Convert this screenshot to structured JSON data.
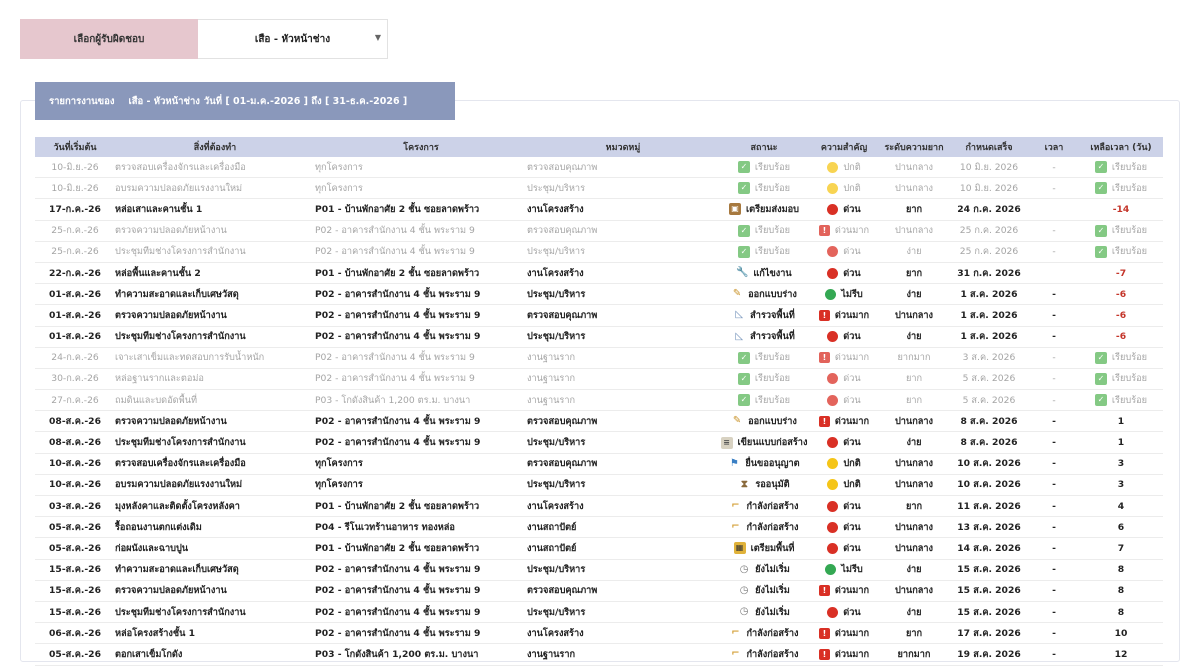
{
  "responsible": {
    "label": "เลือกผู้รับผิดชอบ",
    "selected": "เสือ - หัวหน้าช่าง"
  },
  "banner": {
    "prefix": "รายการงานของ",
    "person": "เสือ - หัวหน้าช่าง",
    "range": "วันที่ [ 01-ม.ค.-2026 ] ถึง [ 31-ธ.ค.-2026 ]"
  },
  "headers": [
    "วันที่เริ่มต้น",
    "สิ่งที่ต้องทำ",
    "โครงการ",
    "หมวดหมู่",
    "สถานะ",
    "ความสำคัญ",
    "ระดับความยาก",
    "กำหนดเสร็จ",
    "เวลา",
    "เหลือเวลา (วัน)"
  ],
  "rows": [
    {
      "state": "done",
      "start": "10-มิ.ย.-26",
      "task": "ตรวจสอบเครื่องจักรและเครื่องมือ",
      "project": "ทุกโครงการ",
      "category": "ตรวจสอบคุณภาพ",
      "status_icon": "check-icon",
      "status": "เรียบร้อย",
      "priority_icon": "yellow-dot",
      "priority": "ปกติ",
      "difficulty": "ปานกลาง",
      "due": "10 มิ.ย. 2026",
      "time": "-",
      "remain_icon": "check-icon",
      "remain": "เรียบร้อย"
    },
    {
      "state": "done",
      "start": "10-มิ.ย.-26",
      "task": "อบรมความปลอดภัยแรงงานใหม่",
      "project": "ทุกโครงการ",
      "category": "ประชุม/บริหาร",
      "status_icon": "check-icon",
      "status": "เรียบร้อย",
      "priority_icon": "yellow-dot",
      "priority": "ปกติ",
      "difficulty": "ปานกลาง",
      "due": "10 มิ.ย. 2026",
      "time": "-",
      "remain_icon": "check-icon",
      "remain": "เรียบร้อย"
    },
    {
      "state": "active",
      "start": "17-ก.ค.-26",
      "task": "หล่อเสาและคานชั้น 1",
      "project": "P01 - บ้านพักอาศัย 2 ชั้น ซอยลาดพร้าว",
      "category": "งานโครงสร้าง",
      "status_icon": "box-icon",
      "status": "เตรียมส่งมอบ",
      "priority_icon": "red-dot",
      "priority": "ด่วน",
      "difficulty": "ยาก",
      "due": "24 ก.ค. 2026",
      "time": "",
      "remain_icon": "",
      "remain": "-14",
      "neg": true
    },
    {
      "state": "done",
      "start": "25-ก.ค.-26",
      "task": "ตรวจความปลอดภัยหน้างาน",
      "project": "P02 - อาคารสำนักงาน 4 ชั้น พระราม 9",
      "category": "ตรวจสอบคุณภาพ",
      "status_icon": "check-icon",
      "status": "เรียบร้อย",
      "priority_icon": "bang",
      "priority": "ด่วนมาก",
      "difficulty": "ปานกลาง",
      "due": "25 ก.ค. 2026",
      "time": "-",
      "remain_icon": "check-icon",
      "remain": "เรียบร้อย"
    },
    {
      "state": "done",
      "start": "25-ก.ค.-26",
      "task": "ประชุมทีมช่างโครงการสำนักงาน",
      "project": "P02 - อาคารสำนักงาน 4 ชั้น พระราม 9",
      "category": "ประชุม/บริหาร",
      "status_icon": "check-icon",
      "status": "เรียบร้อย",
      "priority_icon": "red-dot",
      "priority": "ด่วน",
      "difficulty": "ง่าย",
      "due": "25 ก.ค. 2026",
      "time": "-",
      "remain_icon": "check-icon",
      "remain": "เรียบร้อย"
    },
    {
      "state": "active",
      "start": "22-ก.ค.-26",
      "task": "หล่อพื้นและคานชั้น 2",
      "project": "P01 - บ้านพักอาศัย 2 ชั้น ซอยลาดพร้าว",
      "category": "งานโครงสร้าง",
      "status_icon": "wrench-icon",
      "status": "แก้ไขงาน",
      "priority_icon": "red-dot",
      "priority": "ด่วน",
      "difficulty": "ยาก",
      "due": "31 ก.ค. 2026",
      "time": "",
      "remain_icon": "",
      "remain": "-7",
      "neg": true
    },
    {
      "state": "active",
      "start": "01-ส.ค.-26",
      "task": "ทำความสะอาดและเก็บเศษวัสดุ",
      "project": "P02 - อาคารสำนักงาน 4 ชั้น พระราม 9",
      "category": "ประชุม/บริหาร",
      "status_icon": "pencil-icon",
      "status": "ออกแบบร่าง",
      "priority_icon": "green-dot",
      "priority": "ไม่รีบ",
      "difficulty": "ง่าย",
      "due": "1 ส.ค. 2026",
      "time": "-",
      "remain_icon": "",
      "remain": "-6",
      "neg": true
    },
    {
      "state": "active",
      "start": "01-ส.ค.-26",
      "task": "ตรวจความปลอดภัยหน้างาน",
      "project": "P02 - อาคารสำนักงาน 4 ชั้น พระราม 9",
      "category": "ตรวจสอบคุณภาพ",
      "status_icon": "ruler-icon",
      "status": "สำรวจพื้นที่",
      "priority_icon": "bang",
      "priority": "ด่วนมาก",
      "difficulty": "ปานกลาง",
      "due": "1 ส.ค. 2026",
      "time": "-",
      "remain_icon": "",
      "remain": "-6",
      "neg": true
    },
    {
      "state": "active",
      "start": "01-ส.ค.-26",
      "task": "ประชุมทีมช่างโครงการสำนักงาน",
      "project": "P02 - อาคารสำนักงาน 4 ชั้น พระราม 9",
      "category": "ประชุม/บริหาร",
      "status_icon": "ruler-icon",
      "status": "สำรวจพื้นที่",
      "priority_icon": "red-dot",
      "priority": "ด่วน",
      "difficulty": "ง่าย",
      "due": "1 ส.ค. 2026",
      "time": "-",
      "remain_icon": "",
      "remain": "-6",
      "neg": true
    },
    {
      "state": "done",
      "start": "24-ก.ค.-26",
      "task": "เจาะเสาเข็มและทดสอบการรับน้ำหนัก",
      "project": "P02 - อาคารสำนักงาน 4 ชั้น พระราม 9",
      "category": "งานฐานราก",
      "status_icon": "check-icon",
      "status": "เรียบร้อย",
      "priority_icon": "bang",
      "priority": "ด่วนมาก",
      "difficulty": "ยากมาก",
      "due": "3 ส.ค. 2026",
      "time": "-",
      "remain_icon": "check-icon",
      "remain": "เรียบร้อย"
    },
    {
      "state": "done",
      "start": "30-ก.ค.-26",
      "task": "หล่อฐานรากและตอม่อ",
      "project": "P02 - อาคารสำนักงาน 4 ชั้น พระราม 9",
      "category": "งานฐานราก",
      "status_icon": "check-icon",
      "status": "เรียบร้อย",
      "priority_icon": "red-dot",
      "priority": "ด่วน",
      "difficulty": "ยาก",
      "due": "5 ส.ค. 2026",
      "time": "-",
      "remain_icon": "check-icon",
      "remain": "เรียบร้อย"
    },
    {
      "state": "done",
      "start": "27-ก.ค.-26",
      "task": "ถมดินและบดอัดพื้นที่",
      "project": "P03 - โกดังสินค้า 1,200 ตร.ม. บางนา",
      "category": "งานฐานราก",
      "status_icon": "check-icon",
      "status": "เรียบร้อย",
      "priority_icon": "red-dot",
      "priority": "ด่วน",
      "difficulty": "ยาก",
      "due": "5 ส.ค. 2026",
      "time": "-",
      "remain_icon": "check-icon",
      "remain": "เรียบร้อย"
    },
    {
      "state": "active",
      "start": "08-ส.ค.-26",
      "task": "ตรวจความปลอดภัยหน้างาน",
      "project": "P02 - อาคารสำนักงาน 4 ชั้น พระราม 9",
      "category": "ตรวจสอบคุณภาพ",
      "status_icon": "pencil-icon",
      "status": "ออกแบบร่าง",
      "priority_icon": "bang",
      "priority": "ด่วนมาก",
      "difficulty": "ปานกลาง",
      "due": "8 ส.ค. 2026",
      "time": "-",
      "remain_icon": "",
      "remain": "1"
    },
    {
      "state": "active",
      "start": "08-ส.ค.-26",
      "task": "ประชุมทีมช่างโครงการสำนักงาน",
      "project": "P02 - อาคารสำนักงาน 4 ชั้น พระราม 9",
      "category": "ประชุม/บริหาร",
      "status_icon": "doc-icon",
      "status": "เขียนแบบก่อสร้าง",
      "priority_icon": "red-dot",
      "priority": "ด่วน",
      "difficulty": "ง่าย",
      "due": "8 ส.ค. 2026",
      "time": "-",
      "remain_icon": "",
      "remain": "1"
    },
    {
      "state": "active",
      "start": "10-ส.ค.-26",
      "task": "ตรวจสอบเครื่องจักรและเครื่องมือ",
      "project": "ทุกโครงการ",
      "category": "ตรวจสอบคุณภาพ",
      "status_icon": "sign-icon",
      "status": "ยื่นขออนุญาต",
      "priority_icon": "yellow-dot",
      "priority": "ปกติ",
      "difficulty": "ปานกลาง",
      "due": "10 ส.ค. 2026",
      "time": "-",
      "remain_icon": "",
      "remain": "3"
    },
    {
      "state": "active",
      "start": "10-ส.ค.-26",
      "task": "อบรมความปลอดภัยแรงงานใหม่",
      "project": "ทุกโครงการ",
      "category": "ประชุม/บริหาร",
      "status_icon": "hourglass-icon",
      "status": "รออนุมัติ",
      "priority_icon": "yellow-dot",
      "priority": "ปกติ",
      "difficulty": "ปานกลาง",
      "due": "10 ส.ค. 2026",
      "time": "-",
      "remain_icon": "",
      "remain": "3"
    },
    {
      "state": "active",
      "start": "03-ส.ค.-26",
      "task": "มุงหลังคาและติดตั้งโครงหลังคา",
      "project": "P01 - บ้านพักอาศัย 2 ชั้น ซอยลาดพร้าว",
      "category": "งานโครงสร้าง",
      "status_icon": "crane-icon",
      "status": "กำลังก่อสร้าง",
      "priority_icon": "red-dot",
      "priority": "ด่วน",
      "difficulty": "ยาก",
      "due": "11 ส.ค. 2026",
      "time": "-",
      "remain_icon": "",
      "remain": "4"
    },
    {
      "state": "active",
      "start": "05-ส.ค.-26",
      "task": "รื้อถอนงานตกแต่งเดิม",
      "project": "P04 - รีโนเวทร้านอาหาร ทองหล่อ",
      "category": "งานสถาปัตย์",
      "status_icon": "crane-icon",
      "status": "กำลังก่อสร้าง",
      "priority_icon": "red-dot",
      "priority": "ด่วน",
      "difficulty": "ปานกลาง",
      "due": "13 ส.ค. 2026",
      "time": "-",
      "remain_icon": "",
      "remain": "6"
    },
    {
      "state": "active",
      "start": "05-ส.ค.-26",
      "task": "ก่อผนังและฉาบปูน",
      "project": "P01 - บ้านพักอาศัย 2 ชั้น ซอยลาดพร้าว",
      "category": "งานสถาปัตย์",
      "status_icon": "barrier-icon",
      "status": "เตรียมพื้นที่",
      "priority_icon": "red-dot",
      "priority": "ด่วน",
      "difficulty": "ปานกลาง",
      "due": "14 ส.ค. 2026",
      "time": "-",
      "remain_icon": "",
      "remain": "7"
    },
    {
      "state": "active",
      "start": "15-ส.ค.-26",
      "task": "ทำความสะอาดและเก็บเศษวัสดุ",
      "project": "P02 - อาคารสำนักงาน 4 ชั้น พระราม 9",
      "category": "ประชุม/บริหาร",
      "status_icon": "clock-icon",
      "status": "ยังไม่เริ่ม",
      "priority_icon": "green-dot",
      "priority": "ไม่รีบ",
      "difficulty": "ง่าย",
      "due": "15 ส.ค. 2026",
      "time": "-",
      "remain_icon": "",
      "remain": "8"
    },
    {
      "state": "active",
      "start": "15-ส.ค.-26",
      "task": "ตรวจความปลอดภัยหน้างาน",
      "project": "P02 - อาคารสำนักงาน 4 ชั้น พระราม 9",
      "category": "ตรวจสอบคุณภาพ",
      "status_icon": "clock-icon",
      "status": "ยังไม่เริ่ม",
      "priority_icon": "bang",
      "priority": "ด่วนมาก",
      "difficulty": "ปานกลาง",
      "due": "15 ส.ค. 2026",
      "time": "-",
      "remain_icon": "",
      "remain": "8"
    },
    {
      "state": "active",
      "start": "15-ส.ค.-26",
      "task": "ประชุมทีมช่างโครงการสำนักงาน",
      "project": "P02 - อาคารสำนักงาน 4 ชั้น พระราม 9",
      "category": "ประชุม/บริหาร",
      "status_icon": "clock-icon",
      "status": "ยังไม่เริ่ม",
      "priority_icon": "red-dot",
      "priority": "ด่วน",
      "difficulty": "ง่าย",
      "due": "15 ส.ค. 2026",
      "time": "-",
      "remain_icon": "",
      "remain": "8"
    },
    {
      "state": "active",
      "start": "06-ส.ค.-26",
      "task": "หล่อโครงสร้างชั้น 1",
      "project": "P02 - อาคารสำนักงาน 4 ชั้น พระราม 9",
      "category": "งานโครงสร้าง",
      "status_icon": "crane-icon",
      "status": "กำลังก่อสร้าง",
      "priority_icon": "bang",
      "priority": "ด่วนมาก",
      "difficulty": "ยาก",
      "due": "17 ส.ค. 2026",
      "time": "-",
      "remain_icon": "",
      "remain": "10"
    },
    {
      "state": "active",
      "start": "05-ส.ค.-26",
      "task": "ตอกเสาเข็มโกดัง",
      "project": "P03 - โกดังสินค้า 1,200 ตร.ม. บางนา",
      "category": "งานฐานราก",
      "status_icon": "crane-icon",
      "status": "กำลังก่อสร้าง",
      "priority_icon": "bang",
      "priority": "ด่วนมาก",
      "difficulty": "ยากมาก",
      "due": "19 ส.ค. 2026",
      "time": "-",
      "remain_icon": "",
      "remain": "12"
    }
  ],
  "colors": {
    "header_bg": "#ccd2e8",
    "banner_bg": "#8a98bb",
    "label_bg": "#e6c7ce",
    "negative": "#c4352a"
  }
}
